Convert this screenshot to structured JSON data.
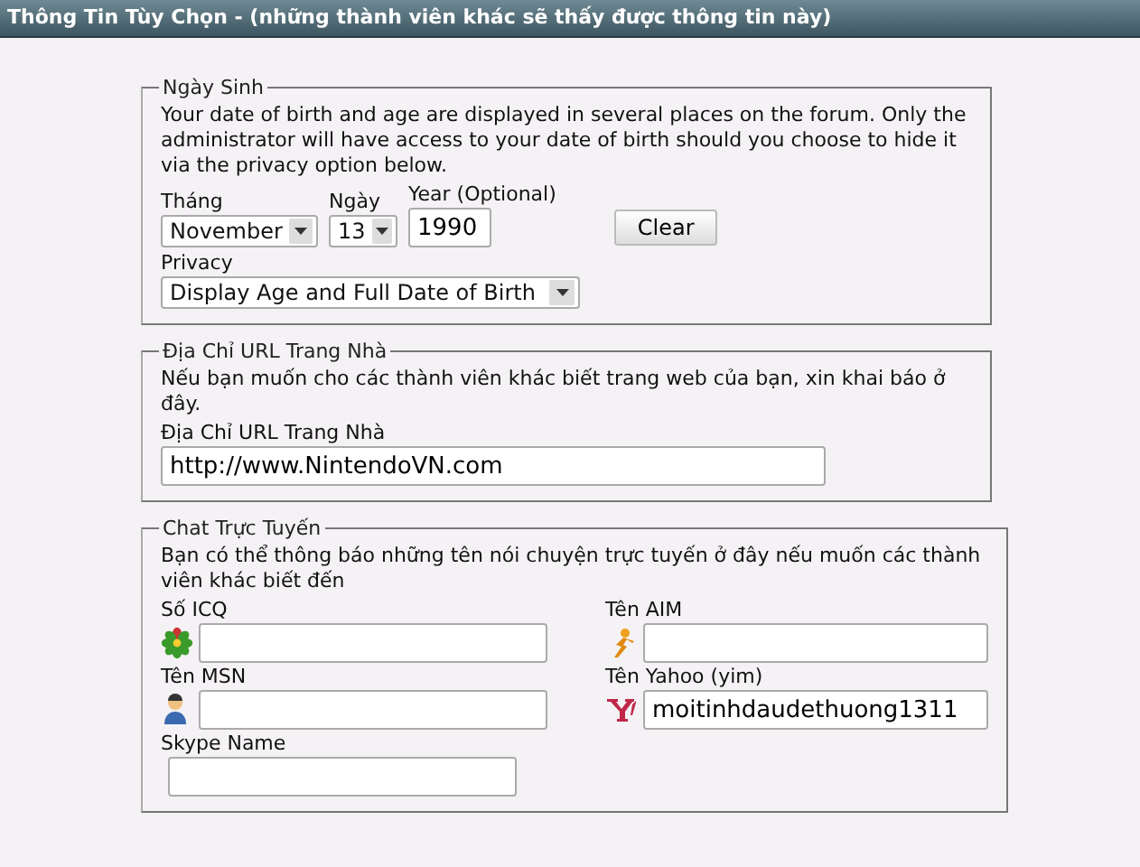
{
  "header": {
    "title": "Thông Tin Tùy Chọn - (những thành viên khác sẽ thấy được thông tin này)"
  },
  "birthday": {
    "legend": "Ngày Sinh",
    "description": "Your date of birth and age are displayed in several places on the forum. Only the administrator will have access to your date of birth should you choose to hide it via the privacy option below.",
    "month": {
      "label": "Tháng",
      "value": "November"
    },
    "day": {
      "label": "Ngày",
      "value": "13"
    },
    "year": {
      "label": "Year (Optional)",
      "value": "1990"
    },
    "clear_button": "Clear",
    "privacy": {
      "label": "Privacy",
      "value": "Display Age and Full Date of Birth"
    }
  },
  "homepage": {
    "legend": "Địa Chỉ URL Trang Nhà",
    "description": "Nếu bạn muốn cho các thành viên khác biết trang web của bạn, xin khai báo ở đây.",
    "label": "Địa Chỉ URL Trang Nhà",
    "value": "http://www.NintendoVN.com"
  },
  "messaging": {
    "legend": "Chat Trực Tuyến",
    "description": "Bạn có thể thông báo những tên nói chuyện trực tuyến ở đây nếu muốn các thành viên khác biết đến",
    "fields": [
      {
        "label": "Số ICQ",
        "kind": "icq"
      },
      {
        "label": "Tên AIM",
        "kind": "aim"
      },
      {
        "label": "Tên MSN",
        "kind": "msn"
      },
      {
        "label": "Tên Yahoo (yim)",
        "kind": "yahoo",
        "value": "moitinhdaudethuong1311"
      },
      {
        "label": "Skype Name",
        "kind": "skype"
      }
    ]
  }
}
